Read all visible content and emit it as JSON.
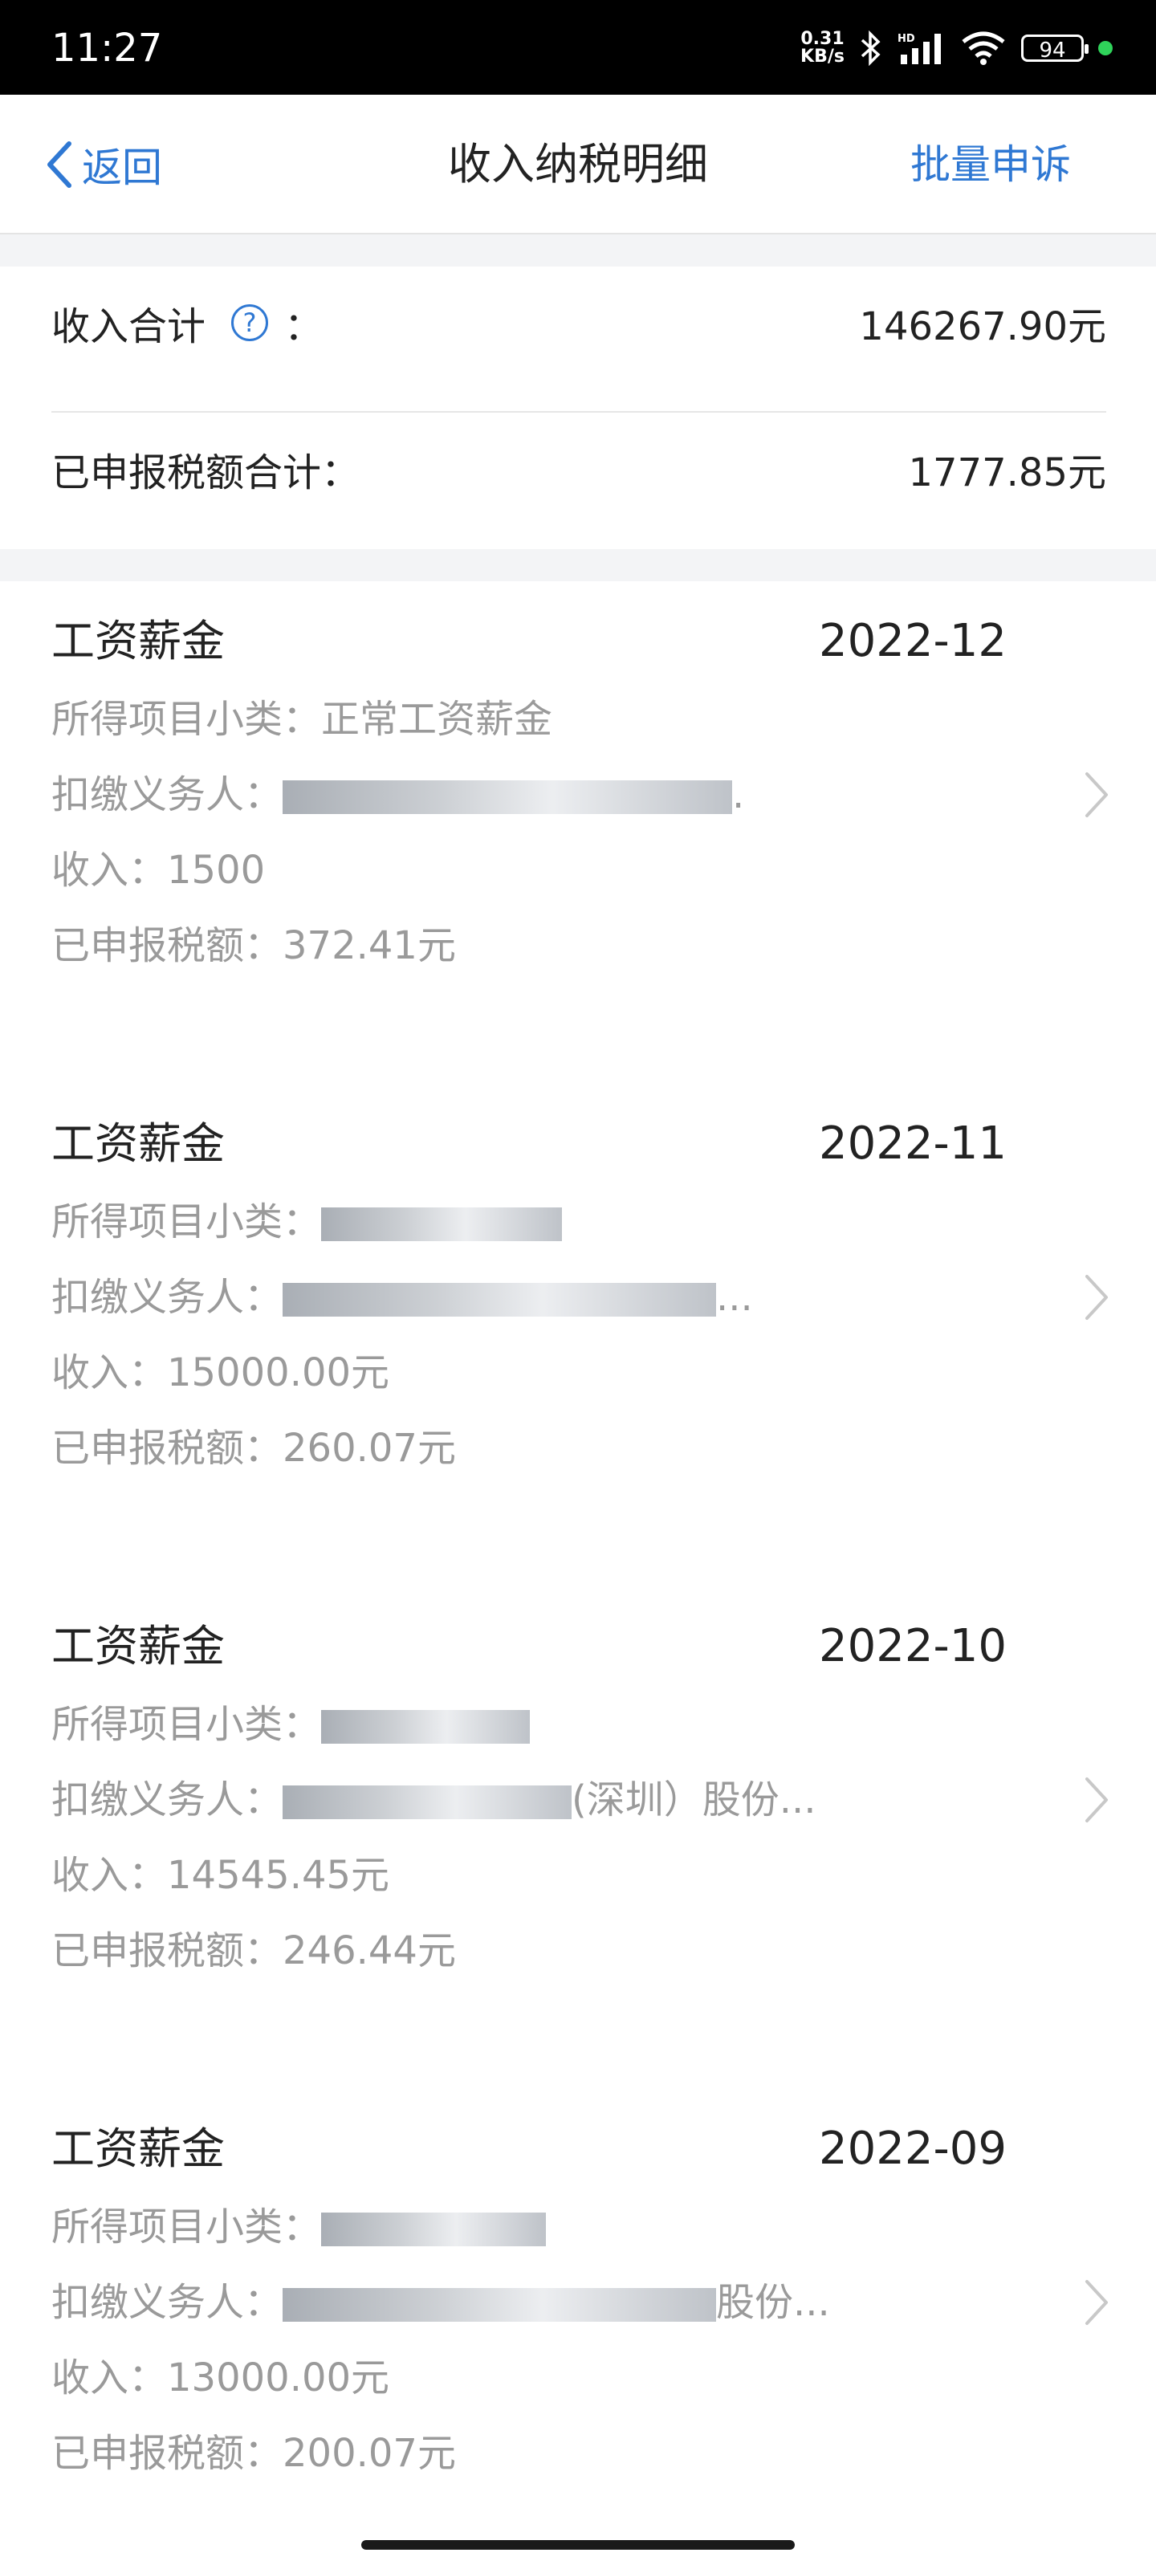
{
  "status_bar": {
    "time": "11:27",
    "net_speed_value": "0.31",
    "net_speed_unit": "KB/s",
    "battery": "94"
  },
  "nav": {
    "back_label": "返回",
    "title": "收入纳税明细",
    "appeal_label": "批量申诉"
  },
  "summary": {
    "income_label": "收入合计",
    "income_colon": "：",
    "income_value": "146267.90元",
    "tax_label": "已申报税额合计：",
    "tax_value": "1777.85元"
  },
  "labels": {
    "subtype": "所得项目小类：",
    "payer": "扣缴义务人：",
    "income": "收入：",
    "tax": "已申报税额："
  },
  "records": [
    {
      "title": "工资薪金",
      "date": "2022-12",
      "subtype": "正常工资薪金",
      "payer": ".",
      "income": "1500",
      "tax": "372.41元"
    },
    {
      "title": "工资薪金",
      "date": "2022-11",
      "subtype": "",
      "payer": "...",
      "income": "15000.00元",
      "tax": "260.07元"
    },
    {
      "title": "工资薪金",
      "date": "2022-10",
      "subtype": "",
      "payer": "(深圳）股份...",
      "income": "14545.45元",
      "tax": "246.44元"
    },
    {
      "title": "工资薪金",
      "date": "2022-09",
      "subtype": "",
      "payer": "股份...",
      "income": "13000.00元",
      "tax": "200.07元"
    }
  ],
  "colors": {
    "accent": "#2f78d3",
    "secondary_text": "#9a9a9a",
    "separator": "#f3f4f6"
  }
}
